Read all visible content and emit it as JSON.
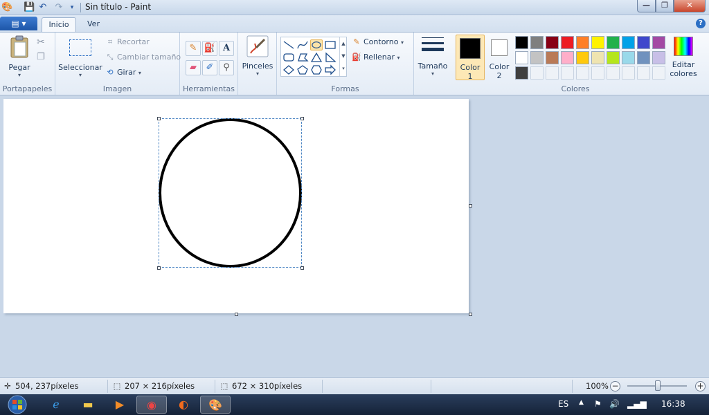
{
  "window": {
    "title": "Sin título - Paint"
  },
  "menu": {
    "file_label": "▤ ▾",
    "tabs": [
      {
        "label": "Inicio",
        "active": true
      },
      {
        "label": "Ver",
        "active": false
      }
    ]
  },
  "ribbon": {
    "clipboard": {
      "paste_label": "Pegar",
      "group_label": "Portapapeles"
    },
    "image": {
      "select_label": "Seleccionar",
      "crop_label": "Recortar",
      "resize_label": "Cambiar tamaño",
      "rotate_label": "Girar",
      "group_label": "Imagen"
    },
    "tools": {
      "group_label": "Herramientas"
    },
    "brushes": {
      "label": "Pinceles"
    },
    "shapes": {
      "outline_label": "Contorno",
      "fill_label": "Rellenar",
      "group_label": "Formas"
    },
    "size": {
      "label": "Tamaño"
    },
    "colors": {
      "color1_label": "Color",
      "color1_num": "1",
      "color2_label": "Color",
      "color2_num": "2",
      "edit_label": "Editar",
      "edit_label2": "colores",
      "group_label": "Colores",
      "color1_value": "#000000",
      "color2_value": "#ffffff",
      "palette": [
        "#000000",
        "#7f7f7f",
        "#880015",
        "#ed1c24",
        "#ff7f27",
        "#fff200",
        "#22b14c",
        "#00a2e8",
        "#3f48cc",
        "#a349a4",
        "#ffffff",
        "#c3c3c3",
        "#b97a57",
        "#ffaec9",
        "#ffc90e",
        "#efe4b0",
        "#b5e61d",
        "#99d9ea",
        "#7092be",
        "#c8bfe7"
      ],
      "custom_row": [
        "#3f3f3f"
      ]
    }
  },
  "status": {
    "cursor_pos": "504, 237píxeles",
    "selection_size": "207 × 216píxeles",
    "canvas_size": "672 × 310píxeles",
    "zoom": "100%",
    "zoom_level": 1.0
  },
  "taskbar": {
    "language": "ES",
    "clock": "16:38",
    "apps": [
      "internet-explorer",
      "file-explorer",
      "media-player",
      "chrome",
      "firefox",
      "paint"
    ]
  }
}
